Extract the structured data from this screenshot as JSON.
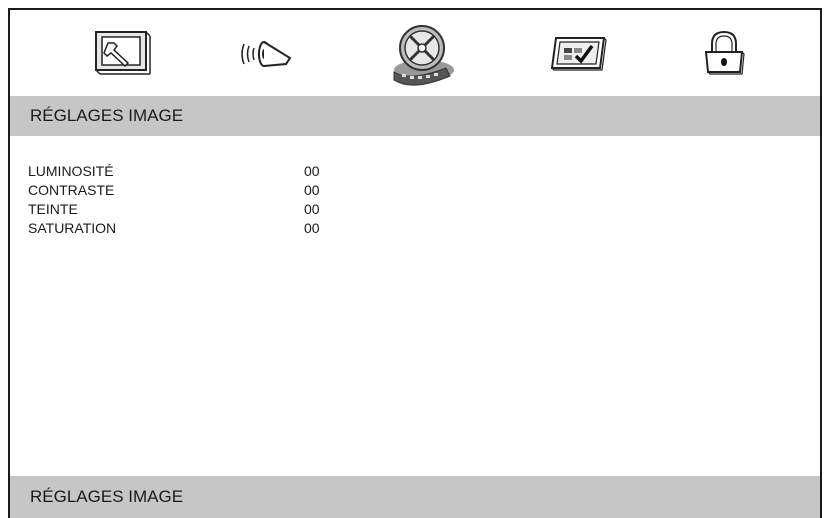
{
  "toolbar": {
    "icons": [
      {
        "name": "general-setup",
        "icon": "wrench-monitor-icon"
      },
      {
        "name": "audio-setup",
        "icon": "speaker-icon"
      },
      {
        "name": "video-setup",
        "icon": "film-reel-icon",
        "selected": true
      },
      {
        "name": "preferences",
        "icon": "checkmark-screen-icon"
      },
      {
        "name": "password",
        "icon": "padlock-icon"
      }
    ]
  },
  "header": {
    "title": "RÉGLAGES IMAGE"
  },
  "settings": [
    {
      "label": "LUMINOSITÉ",
      "value": "00"
    },
    {
      "label": "CONTRASTE",
      "value": "00"
    },
    {
      "label": "TEINTE",
      "value": "00"
    },
    {
      "label": "SATURATION",
      "value": "00"
    }
  ],
  "footer": {
    "text": "RÉGLAGES IMAGE"
  }
}
